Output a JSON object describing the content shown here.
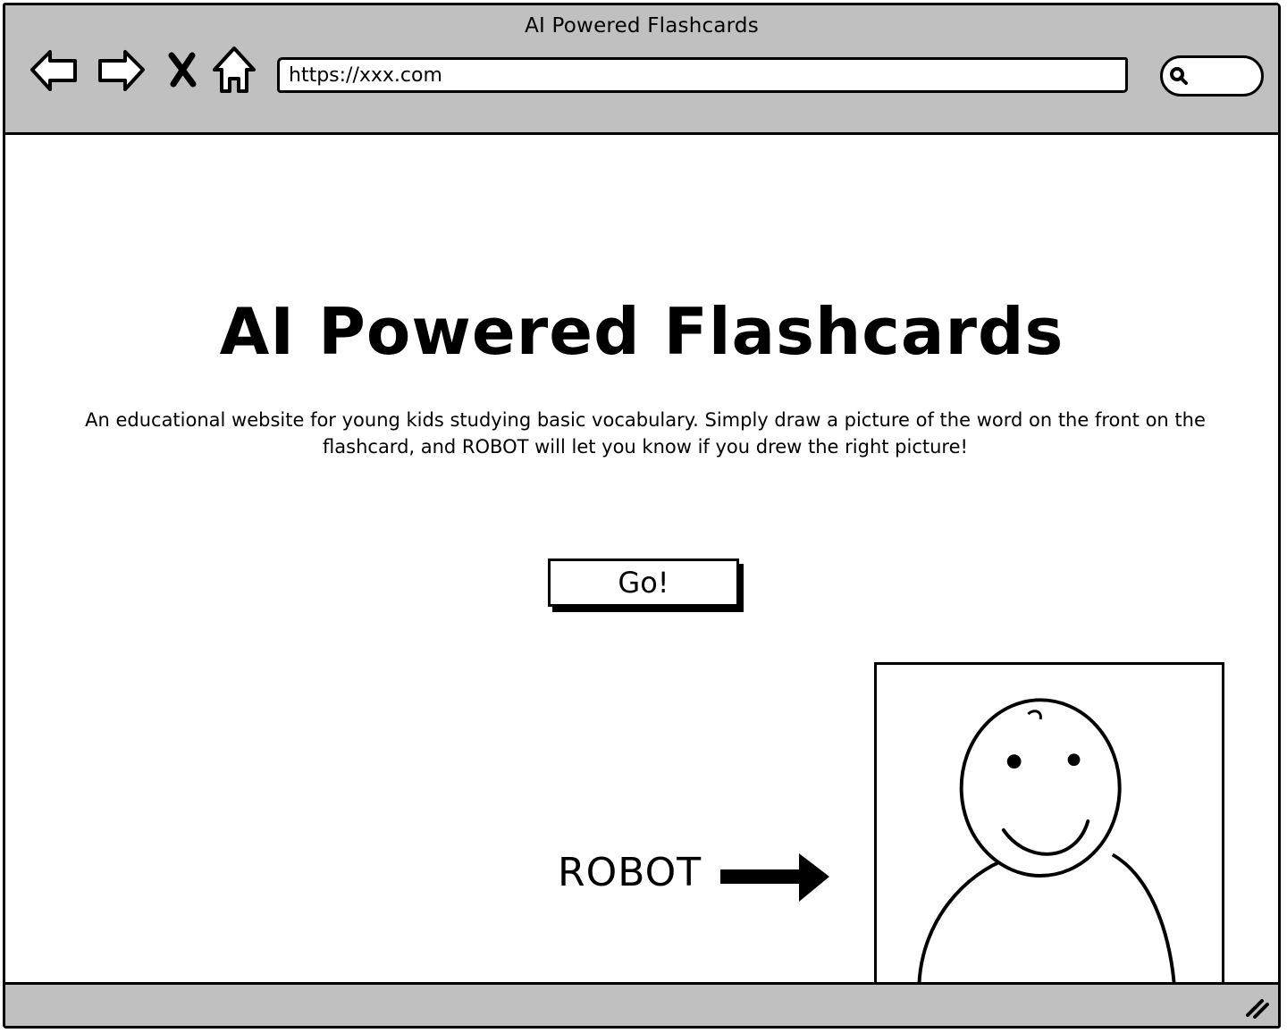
{
  "browser": {
    "window_title": "AI Powered Flashcards",
    "address_url": "https://xxx.com",
    "search_placeholder": "",
    "icons": {
      "back": "arrow-left-icon",
      "forward": "arrow-right-icon",
      "stop": "close-x-icon",
      "home": "home-icon",
      "search": "magnifier-icon",
      "resize": "resize-grip-icon"
    }
  },
  "page": {
    "title": "AI Powered Flashcards",
    "description": "An educational website for young kids studying basic vocabulary. Simply draw a picture of the word on the front on the flashcard, and ROBOT will let you know if you drew the right picture!",
    "go_button_label": "Go!",
    "robot_label": "ROBOT",
    "robot_image": "smiley-robot-figure"
  }
}
